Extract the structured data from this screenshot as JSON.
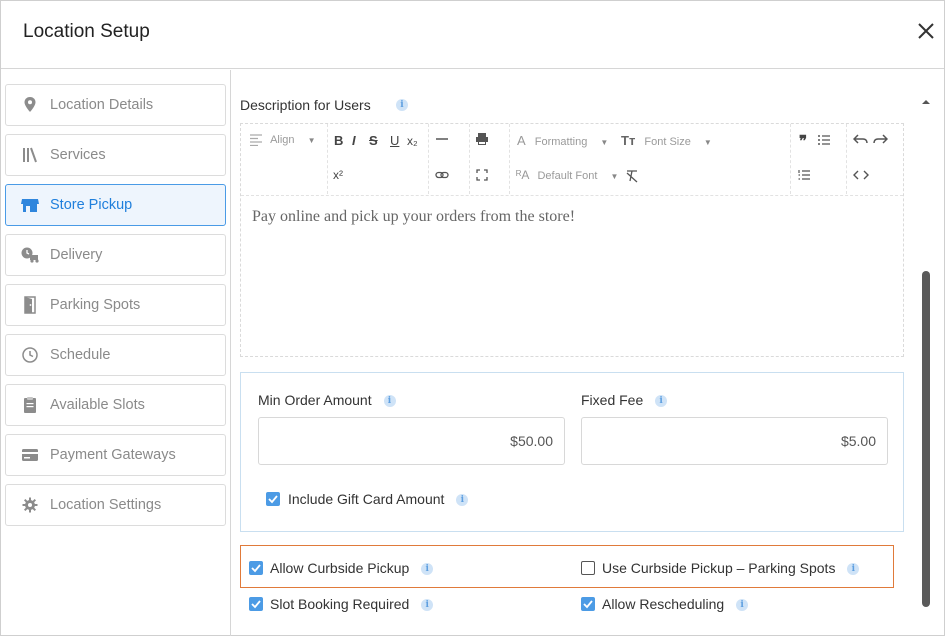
{
  "window": {
    "title": "Location Setup",
    "close_icon": "close-icon"
  },
  "sidebar": {
    "items": [
      {
        "label": "Location Details",
        "icon": "map-pin-icon",
        "active": false
      },
      {
        "label": "Services",
        "icon": "services-icon",
        "active": false
      },
      {
        "label": "Store Pickup",
        "icon": "store-icon",
        "active": true
      },
      {
        "label": "Delivery",
        "icon": "delivery-icon",
        "active": false
      },
      {
        "label": "Parking Spots",
        "icon": "parking-door-icon",
        "active": false
      },
      {
        "label": "Schedule",
        "icon": "clock-icon",
        "active": false
      },
      {
        "label": "Available Slots",
        "icon": "clipboard-icon",
        "active": false
      },
      {
        "label": "Payment Gateways",
        "icon": "card-icon",
        "active": false
      },
      {
        "label": "Location Settings",
        "icon": "gear-icon",
        "active": false
      }
    ]
  },
  "description": {
    "label": "Description for Users",
    "text": "Pay online and pick up your orders from the store!"
  },
  "toolbar": {
    "align": "Align",
    "formatting": "Formatting",
    "font_size": "Font Size",
    "default_font": "Default Font",
    "bold": "B",
    "italic": "I",
    "strike": "S",
    "underline": "U",
    "subscript": "x₂",
    "superscript": "x²"
  },
  "amounts": {
    "min_order_label": "Min Order Amount",
    "min_order_value": "$50.00",
    "fixed_fee_label": "Fixed Fee",
    "fixed_fee_value": "$5.00",
    "gift_card_label": "Include Gift Card Amount",
    "gift_card_checked": true
  },
  "options": {
    "allow_curbside": {
      "label": "Allow Curbside Pickup",
      "checked": true
    },
    "use_curbside_parking": {
      "label": "Use Curbside Pickup – Parking Spots",
      "checked": false
    },
    "slot_booking": {
      "label": "Slot Booking Required",
      "checked": true
    },
    "allow_rescheduling": {
      "label": "Allow Rescheduling",
      "checked": true
    }
  },
  "colors": {
    "accent": "#1f7fdc",
    "checkbox": "#4c9be5",
    "highlight_border": "#e07a3a",
    "panel_border": "#c9dff0"
  }
}
